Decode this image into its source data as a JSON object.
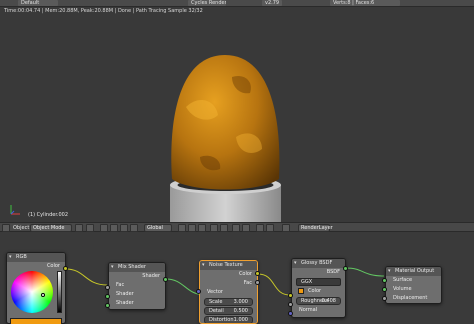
{
  "topbar": {
    "items": [
      "Default",
      "Cycles Render",
      "v2.79",
      "Verts:8 | Faces:6"
    ]
  },
  "viewport": {
    "render_info": "Time:00:04.74 | Mem:20.88M, Peak:20.88M | Done | Path Tracing Sample 32/32",
    "object_label": "(1) Cylinder.002",
    "object_color": "#d08a10"
  },
  "header": {
    "view": "View",
    "select": "Select",
    "add": "Add",
    "object": "Object",
    "mode": "Object Mode",
    "pivot": "Global",
    "render_layer": "RenderLayer"
  },
  "nodes": {
    "rgb": {
      "title": "RGB",
      "out_color": "Color",
      "color_hex": "#f09a10"
    },
    "mix": {
      "title": "Mix Shader",
      "out_shader": "Shader",
      "in_fac": "Fac",
      "in_shader1": "Shader",
      "in_shader2": "Shader"
    },
    "noise": {
      "title": "Noise Texture",
      "out_color": "Color",
      "out_fac": "Fac",
      "in_vector": "Vector",
      "scale_label": "Scale",
      "scale_value": "3.000",
      "detail_label": "Detail",
      "detail_value": "0.500",
      "distortion_label": "Distortion",
      "distortion_value": "1.000"
    },
    "glossy": {
      "title": "Glossy BSDF",
      "out_bsdf": "BSDF",
      "distribution": "GGX",
      "color_label": "Color",
      "roughness_label": "Roughness",
      "roughness_value": "0.408",
      "in_normal": "Normal"
    },
    "output": {
      "title": "Material Output",
      "in_surface": "Surface",
      "in_volume": "Volume",
      "in_displacement": "Displacement"
    }
  }
}
